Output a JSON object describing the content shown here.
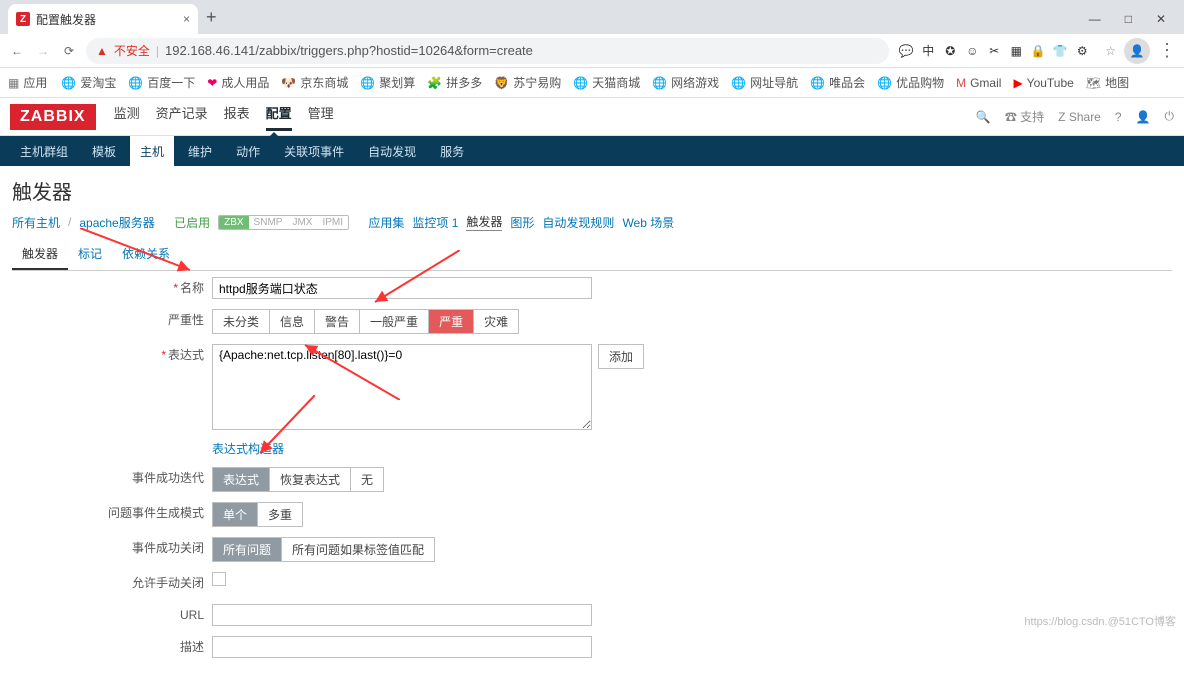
{
  "browser": {
    "tab_icon": "Z",
    "tab_title": "配置触发器",
    "insecure_label": "不安全",
    "url": "192.168.46.141/zabbix/triggers.php?hostid=10264&form=create",
    "extensions": [
      "💬",
      "中",
      "✪",
      "☺",
      "✂",
      "▦",
      "🔒",
      "👕",
      "⚙"
    ]
  },
  "bookmarks_label": "应用",
  "bookmarks": [
    {
      "icon": "🌐",
      "label": "爱淘宝"
    },
    {
      "icon": "🌐",
      "label": "百度一下"
    },
    {
      "icon": "❤",
      "label": "成人用品",
      "color": "#e06"
    },
    {
      "icon": "🐶",
      "label": "京东商城"
    },
    {
      "icon": "🌐",
      "label": "聚划算"
    },
    {
      "icon": "🧩",
      "label": "拼多多",
      "color": "#e33"
    },
    {
      "icon": "🦁",
      "label": "苏宁易购"
    },
    {
      "icon": "🌐",
      "label": "天猫商城"
    },
    {
      "icon": "🌐",
      "label": "网络游戏"
    },
    {
      "icon": "🌐",
      "label": "网址导航"
    },
    {
      "icon": "🌐",
      "label": "唯品会"
    },
    {
      "icon": "🌐",
      "label": "优品购物"
    },
    {
      "icon": "M",
      "label": "Gmail",
      "color": "#d44"
    },
    {
      "icon": "▶",
      "label": "YouTube",
      "color": "#f00"
    },
    {
      "icon": "🗺",
      "label": "地图"
    }
  ],
  "zabbix": {
    "logo": "ZABBIX",
    "nav": [
      "监测",
      "资产记录",
      "报表",
      "配置",
      "管理"
    ],
    "nav_active": "配置",
    "right": {
      "support": "☎ 支持",
      "share": "Z Share"
    },
    "subnav": [
      "主机群组",
      "模板",
      "主机",
      "维护",
      "动作",
      "关联项事件",
      "自动发现",
      "服务"
    ],
    "subnav_active": "主机"
  },
  "page_title": "触发器",
  "crumbs": {
    "all_hosts": "所有主机",
    "host": "apache服务器",
    "enabled": "已启用",
    "tags": {
      "zbx": "ZBX",
      "snmp": "SNMP",
      "jmx": "JMX",
      "ipmi": "IPMI"
    },
    "apps": "应用集",
    "items": "监控项 1",
    "triggers": "触发器",
    "graphs": "图形",
    "discovery": "自动发现规则",
    "web": "Web 场景"
  },
  "form_tabs": [
    "触发器",
    "标记",
    "依赖关系"
  ],
  "form_tab_active": "触发器",
  "labels": {
    "name": "名称",
    "severity": "严重性",
    "expression": "表达式",
    "add": "添加",
    "expr_builder": "表达式构造器",
    "ok_event": "事件成功迭代",
    "problem_mode": "问题事件生成模式",
    "ok_close": "事件成功关闭",
    "manual_close": "允许手动关闭",
    "url": "URL",
    "desc": "描述"
  },
  "values": {
    "name": "httpd服务端口状态",
    "expression": "{Apache:net.tcp.listen[80].last()}=0",
    "url": "",
    "desc": ""
  },
  "severity_opts": [
    "未分类",
    "信息",
    "警告",
    "一般严重",
    "严重",
    "灾难"
  ],
  "severity_selected": "严重",
  "ok_event_opts": [
    "表达式",
    "恢复表达式",
    "无"
  ],
  "ok_event_selected": "表达式",
  "problem_mode_opts": [
    "单个",
    "多重"
  ],
  "problem_mode_selected": "单个",
  "ok_close_opts": [
    "所有问题",
    "所有问题如果标签值匹配"
  ],
  "ok_close_selected": "所有问题",
  "watermark": "https://blog.csdn.@51CTO博客"
}
